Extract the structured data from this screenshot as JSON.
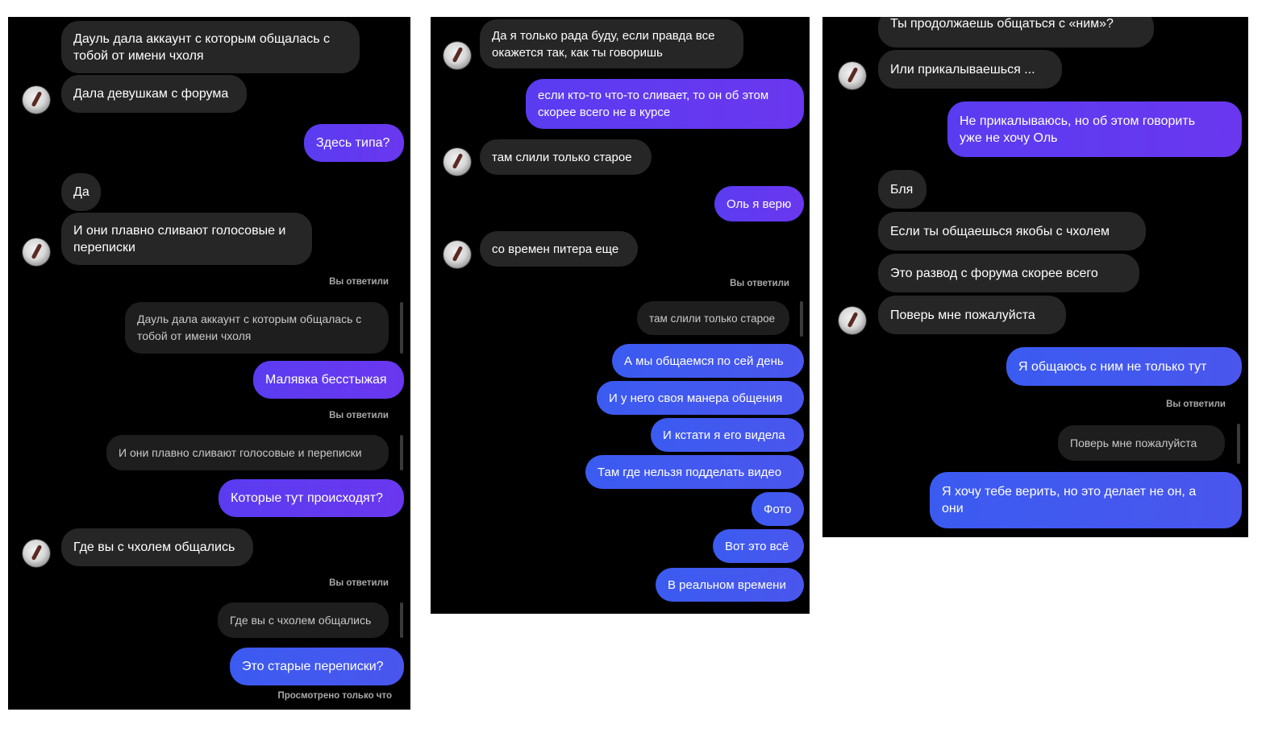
{
  "colors": {
    "incoming": "#262626",
    "outgoing_purple": "#6a37ef",
    "outgoing_blue": "#4a56ee",
    "background": "#000000"
  },
  "avatar_icon": "avatar-icon",
  "panel1": {
    "m1": "Дауль дала аккаунт с которым общалась с\nтобой от имени чхоля",
    "m2": "Дала девушкам с форума",
    "m3": "Здесь типа?",
    "m4": "Да",
    "m5": "И они плавно сливают голосовые и\nпереписки",
    "replied1": "Вы ответили",
    "q1": "Дауль дала аккаунт с которым общалась с\nтобой от имени чхоля",
    "m6": "Малявка бесстыжая",
    "replied2": "Вы ответили",
    "q2": "И они плавно сливают голосовые и переписки",
    "m7": "Которые тут происходят?",
    "m8": "Где вы с чхолем общались",
    "replied3": "Вы ответили",
    "q3": "Где вы с чхолем общались",
    "m9": "Это старые переписки?",
    "seen": "Просмотрено только что"
  },
  "panel2": {
    "m1": "Да я только рада буду, если правда все\nокажется так, как ты говоришь",
    "m2": "если кто-то что-то сливает, то он об этом\nскорее всего не в курсе",
    "m3": "там слили только старое",
    "m4": "Оль я верю",
    "m5": "со времен питера еще",
    "replied": "Вы ответили",
    "q1": "там слили только старое",
    "m6": "А мы общаемся по сей день",
    "m7": "И у него своя манера общения",
    "m8": "И кстати я его видела",
    "m9": "Там где нельзя подделать видео",
    "m10": "Фото",
    "m11": "Вот это всё",
    "m12": "В реальном времени"
  },
  "panel3": {
    "m1": "Ты продолжаешь общаться с «ним»?",
    "m2": "Или прикалываешься ...",
    "m3": "Не прикалываюсь, но об этом говорить\nуже не хочу Оль",
    "m4": "Бля",
    "m5": "Если ты общаешься якобы с чхолем",
    "m6": "Это развод с форума скорее всего",
    "m7": "Поверь мне пожалуйста",
    "m8": "Я общаюсь с ним не только тут",
    "replied": "Вы ответили",
    "q1": "Поверь мне пожалуйста",
    "m9": "Я хочу тебе верить, но это делает не он, а\nони"
  }
}
